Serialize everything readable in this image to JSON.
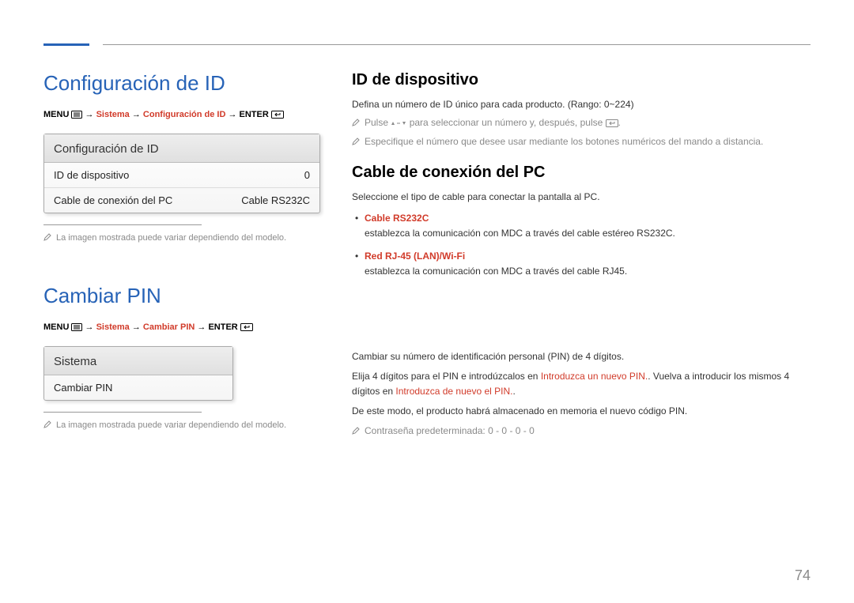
{
  "page_number": "74",
  "left": {
    "section1": {
      "title": "Configuración de ID",
      "breadcrumb": {
        "menu_label": "MENU",
        "arrow": "→",
        "part_system": "Sistema",
        "part_config": "Configuración de ID",
        "enter_label": "ENTER"
      },
      "menu_box": {
        "header": "Configuración de ID",
        "row1_label": "ID de dispositivo",
        "row1_value": "0",
        "row2_label": "Cable de conexión del PC",
        "row2_value": "Cable RS232C"
      },
      "note": "La imagen mostrada puede variar dependiendo del modelo."
    },
    "section2": {
      "title": "Cambiar PIN",
      "breadcrumb": {
        "menu_label": "MENU",
        "arrow": "→",
        "part_system": "Sistema",
        "part_change": "Cambiar PIN",
        "enter_label": "ENTER"
      },
      "menu_box": {
        "header": "Sistema",
        "row1_label": "Cambiar PIN"
      },
      "note": "La imagen mostrada puede variar dependiendo del modelo."
    }
  },
  "right": {
    "s1": {
      "h": "ID de dispositivo",
      "p1": "Defina un número de ID único para cada producto. (Rango: 0~224)",
      "note1_a": "Pulse ",
      "note1_b": " para seleccionar un número y, después, pulse ",
      "note1_c": ".",
      "note2": "Especifique el número que desee usar mediante los botones numéricos del mando a distancia."
    },
    "s2": {
      "h": "Cable de conexión del PC",
      "p1": "Seleccione el tipo de cable para conectar la pantalla al PC.",
      "li1_title": "Cable RS232C",
      "li1_text": "establezca la comunicación con MDC a través del cable estéreo RS232C.",
      "li2_title": "Red RJ-45 (LAN)/Wi-Fi",
      "li2_text": "establezca la comunicación con MDC a través del cable RJ45."
    },
    "s3": {
      "p1": "Cambiar su número de identificación personal (PIN) de 4 dígitos.",
      "p2_a": "Elija 4 dígitos para el PIN e introdúzcalos en ",
      "p2_red1": "Introduzca un nuevo PIN.",
      "p2_b": ". Vuelva a introducir los mismos 4 dígitos en ",
      "p2_red2": "Introduzca de nuevo el PIN.",
      "p2_c": ".",
      "p3": "De este modo, el producto habrá almacenado en memoria el nuevo código PIN.",
      "note": "Contraseña predeterminada: 0 - 0 - 0 - 0"
    }
  }
}
